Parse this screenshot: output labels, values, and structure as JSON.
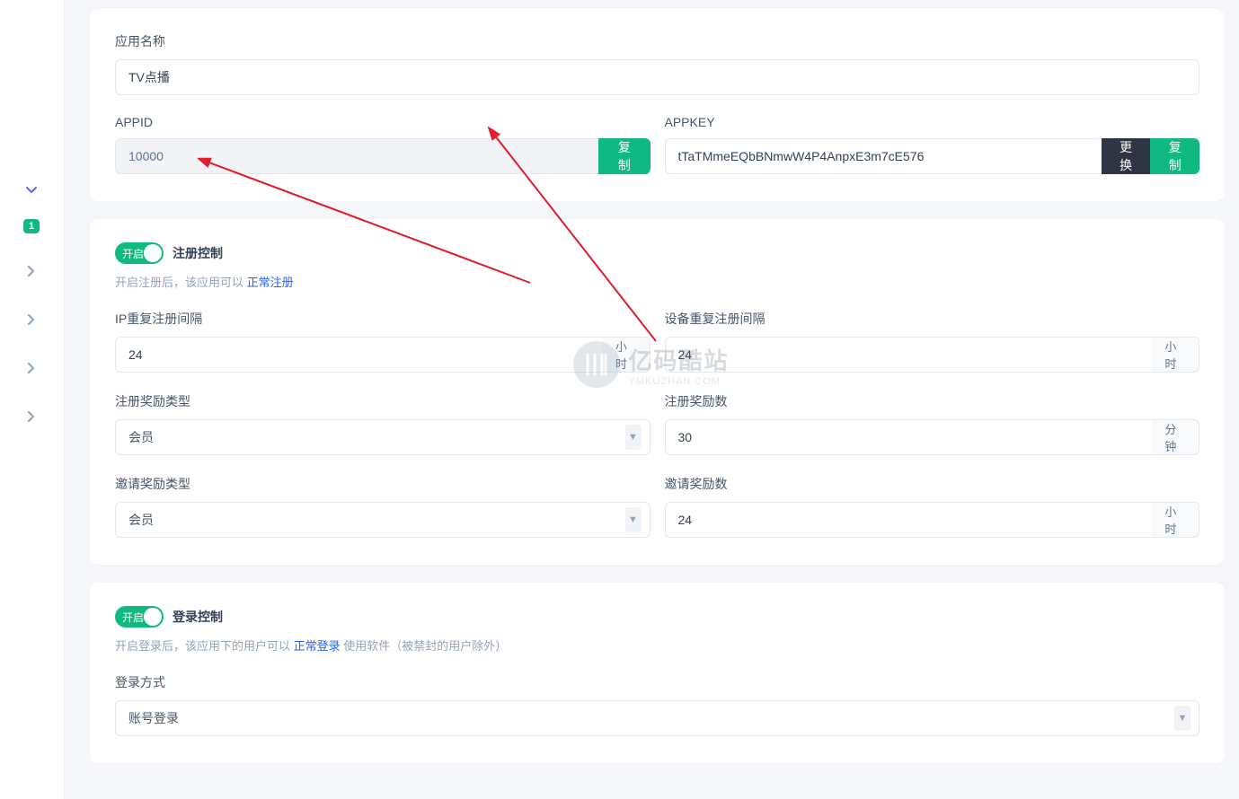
{
  "sidebar": {
    "badge": "1"
  },
  "card1": {
    "app_name_label": "应用名称",
    "app_name_value": "TV点播",
    "appid_label": "APPID",
    "appid_value": "10000",
    "appid_copy": "复制",
    "appkey_label": "APPKEY",
    "appkey_value": "tTaTMmeEQbBNmwW4P4AnpxE3m7cE576",
    "appkey_change": "更换",
    "appkey_copy": "复制"
  },
  "card2": {
    "switch_text": "开启",
    "title": "注册控制",
    "hint_prefix": "开启注册后，该应用可以 ",
    "hint_link": "正常注册",
    "ip_interval_label": "IP重复注册间隔",
    "ip_interval_value": "24",
    "ip_interval_unit": "小时",
    "device_interval_label": "设备重复注册间隔",
    "device_interval_value": "24",
    "device_interval_unit": "小时",
    "reg_reward_type_label": "注册奖励类型",
    "reg_reward_type_value": "会员",
    "reg_reward_num_label": "注册奖励数",
    "reg_reward_num_value": "30",
    "reg_reward_num_unit": "分钟",
    "invite_reward_type_label": "邀请奖励类型",
    "invite_reward_type_value": "会员",
    "invite_reward_num_label": "邀请奖励数",
    "invite_reward_num_value": "24",
    "invite_reward_num_unit": "小时"
  },
  "card3": {
    "switch_text": "开启",
    "title": "登录控制",
    "hint_prefix": "开启登录后，该应用下的用户可以 ",
    "hint_link": "正常登录",
    "hint_suffix": " 使用软件（被禁封的用户除外）",
    "login_method_label": "登录方式",
    "login_method_value": "账号登录"
  },
  "watermark": {
    "cn": "亿码酷站",
    "en": "YMKUZHAN.COM"
  }
}
